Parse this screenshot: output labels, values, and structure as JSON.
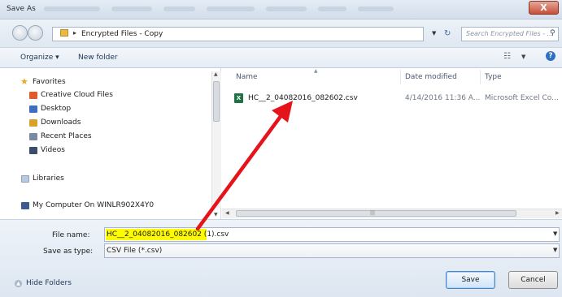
{
  "window": {
    "title": "Save As",
    "close_glyph": "X"
  },
  "nav": {
    "breadcrumb_arrow": "▸",
    "breadcrumb": "Encrypted Files - Copy",
    "search_placeholder": "Search Encrypted Files - ...",
    "icons": {
      "back": "back-arrow-icon",
      "forward": "forward-arrow-icon",
      "refresh": "refresh-icon",
      "search": "search-icon"
    }
  },
  "toolbar": {
    "organize_label": "Organize ▾",
    "new_folder_label": "New folder",
    "help_glyph": "?"
  },
  "sidebar": {
    "favorites_label": "Favorites",
    "items": [
      {
        "label": "Creative Cloud Files",
        "icon": "creative-cloud-icon",
        "color": "#e05a2a"
      },
      {
        "label": "Desktop",
        "icon": "desktop-icon",
        "color": "#3a6fc4"
      },
      {
        "label": "Downloads",
        "icon": "downloads-icon",
        "color": "#d7a12b"
      },
      {
        "label": "Recent Places",
        "icon": "recent-places-icon",
        "color": "#7a8aa0"
      },
      {
        "label": "Videos",
        "icon": "videos-icon",
        "color": "#3b4d6b"
      }
    ],
    "libraries_label": "Libraries",
    "computer_label": "My Computer On WINLR902X4Y0"
  },
  "file_list": {
    "columns": [
      "Name",
      "Date modified",
      "Type"
    ],
    "rows": [
      {
        "name": "HC__2_04082016_082602.csv",
        "date": "4/14/2016 11:36 A...",
        "type": "Microsoft Excel Co...",
        "icon": "excel-file-icon",
        "icon_glyph": "X"
      }
    ]
  },
  "form": {
    "file_name_label": "File name:",
    "file_name_value": "HC__2_04082016_082602 (1).csv",
    "save_type_label": "Save as type:",
    "save_type_value": "CSV File (*.csv)"
  },
  "footer": {
    "hide_folders_label": "Hide Folders",
    "save_label": "Save",
    "cancel_label": "Cancel"
  },
  "annotation": {
    "arrow_color": "#e5141b",
    "highlight_color": "#fffb00"
  }
}
